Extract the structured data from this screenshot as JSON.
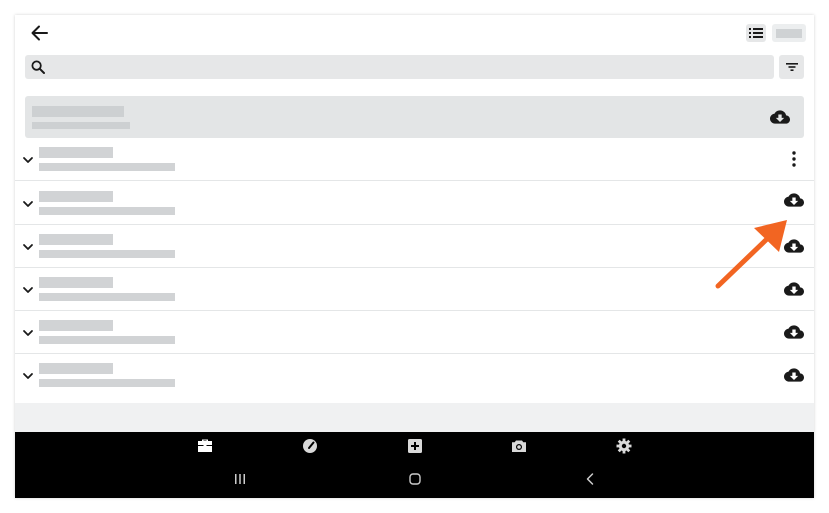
{
  "colors": {
    "accent": "#f26522",
    "placeholder": "#d1d3d5",
    "icon": "#1a1a1a",
    "nav_icon": "#d9d9d9",
    "nav_icon_active": "#ffffff"
  },
  "header": {
    "back_icon": "arrow-left-icon",
    "view_toggle_icon": "list-view-icon"
  },
  "search": {
    "icon": "search-icon",
    "placeholder": "",
    "value": "",
    "filter_icon": "filter-icon"
  },
  "summary": {
    "action_icon": "cloud-download-icon"
  },
  "rows": [
    {
      "action_icon": "more-vertical-icon"
    },
    {
      "action_icon": "cloud-download-icon",
      "highlighted": true
    },
    {
      "action_icon": "cloud-download-icon"
    },
    {
      "action_icon": "cloud-download-icon"
    },
    {
      "action_icon": "cloud-download-icon"
    },
    {
      "action_icon": "cloud-download-icon"
    }
  ],
  "bottom_nav": [
    {
      "icon": "briefcase-icon",
      "active": true
    },
    {
      "icon": "speedometer-icon",
      "active": false
    },
    {
      "icon": "add-box-icon",
      "active": false
    },
    {
      "icon": "camera-icon",
      "active": false
    },
    {
      "icon": "gear-icon",
      "active": false
    }
  ],
  "system_bar": [
    {
      "icon": "recent-apps-icon"
    },
    {
      "icon": "home-icon"
    },
    {
      "icon": "system-back-icon"
    }
  ]
}
